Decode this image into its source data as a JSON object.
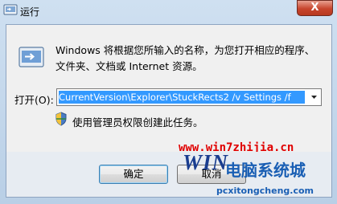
{
  "window": {
    "title": "运行",
    "title_icon": "run-icon",
    "close_icon": "close-icon",
    "close_symbol": "X"
  },
  "main": {
    "description": "Windows 将根据您所输入的名称，为您打开相应的程序、文件夹、文档或 Internet 资源。",
    "open_label": "打开(O):",
    "command_value": "CurrentVersion\\Explorer\\StuckRects2 /v Settings /f",
    "admin_note": "使用管理员权限创建此任务。"
  },
  "buttons": {
    "ok_label": "确定",
    "cancel_label": "取消"
  },
  "watermark": {
    "site_url": "www.win7zhijia.cn",
    "logo_text": "WIN",
    "logo_cn": "电脑系统城",
    "logo_url": "pcxitongcheng.com"
  },
  "colors": {
    "selection": "#3399ff",
    "watermark_red": "#e00000",
    "close_red": "#c7452d"
  }
}
